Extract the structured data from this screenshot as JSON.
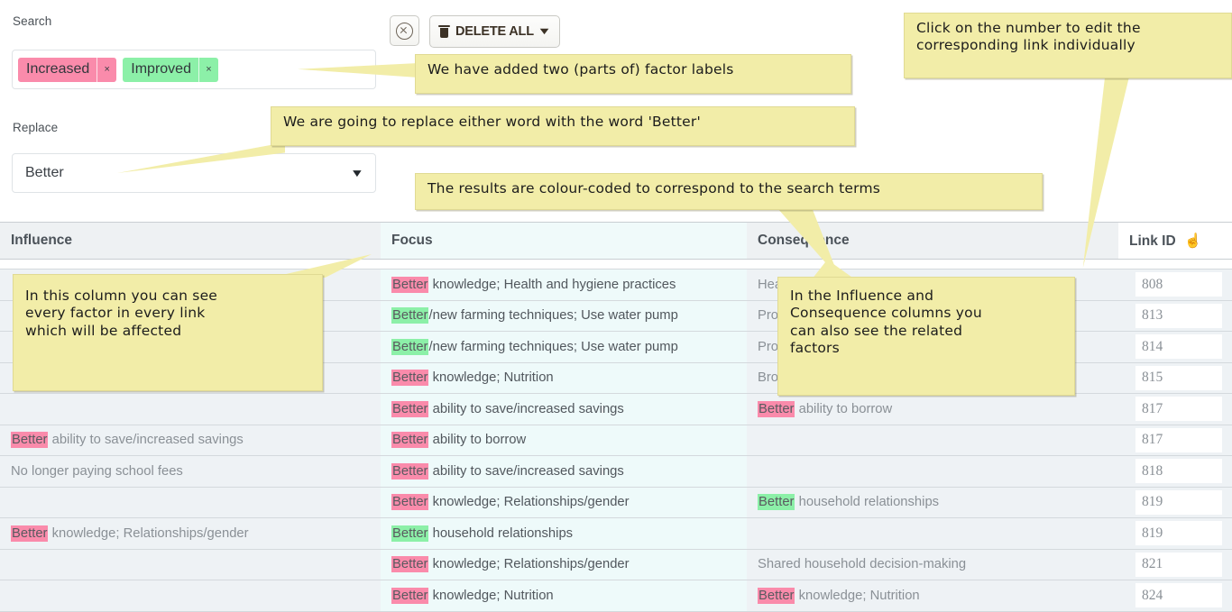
{
  "form": {
    "search_label": "Search",
    "replace_label": "Replace",
    "chips": [
      {
        "text": "Increased",
        "remove": "×",
        "color": "#fa8bab",
        "tone": "pink"
      },
      {
        "text": "Improved",
        "remove": "×",
        "color": "#8cf0a8",
        "tone": "green"
      }
    ],
    "replace_value": "Better",
    "replace_caret": "▼"
  },
  "toolbar": {
    "clear_icon": "clear-circle-icon",
    "delete_all_label": "DELETE ALL",
    "delete_all_caret": "▼",
    "trash_icon": "trash-icon"
  },
  "table": {
    "headers": {
      "influence": "Influence",
      "focus": "Focus",
      "consequence": "Consequence",
      "link_id": "Link ID",
      "link_id_icon": "pointing-hand-icon"
    },
    "rows": [
      {
        "influence": [],
        "focus": [
          {
            "t": "Better",
            "hl": "pink"
          },
          {
            "t": " knowledge; Health and hygiene practices",
            "hl": "none"
          }
        ],
        "consequence": [
          {
            "t": "Hea",
            "hl": "none"
          }
        ],
        "link_id": "808"
      },
      {
        "influence": [],
        "focus": [
          {
            "t": "Better",
            "hl": "green"
          },
          {
            "t": "/new farming techniques; Use water pump",
            "hl": "none"
          }
        ],
        "consequence": [
          {
            "t": "Pro",
            "hl": "none"
          }
        ],
        "link_id": "813"
      },
      {
        "influence": [],
        "focus": [
          {
            "t": "Better",
            "hl": "green"
          },
          {
            "t": "/new farming techniques; Use water pump",
            "hl": "none"
          }
        ],
        "consequence": [
          {
            "t": "Pro",
            "hl": "none"
          }
        ],
        "link_id": "814"
      },
      {
        "influence": [],
        "focus": [
          {
            "t": "Better",
            "hl": "pink"
          },
          {
            "t": " knowledge; Nutrition",
            "hl": "none"
          }
        ],
        "consequence": [
          {
            "t": "Bro",
            "hl": "none"
          }
        ],
        "link_id": "815"
      },
      {
        "influence": [],
        "focus": [
          {
            "t": "Better",
            "hl": "pink"
          },
          {
            "t": " ability to save/increased savings",
            "hl": "none"
          }
        ],
        "consequence": [
          {
            "t": "Better",
            "hl": "pink"
          },
          {
            "t": " ability to borrow",
            "hl": "none"
          }
        ],
        "link_id": "817"
      },
      {
        "influence": [
          {
            "t": "Better",
            "hl": "pink"
          },
          {
            "t": " ability to save/increased savings",
            "hl": "none"
          }
        ],
        "focus": [
          {
            "t": "Better",
            "hl": "pink"
          },
          {
            "t": " ability to borrow",
            "hl": "none"
          }
        ],
        "consequence": [],
        "link_id": "817"
      },
      {
        "influence": [
          {
            "t": "No longer paying school fees",
            "hl": "none"
          }
        ],
        "focus": [
          {
            "t": "Better",
            "hl": "pink"
          },
          {
            "t": " ability to save/increased savings",
            "hl": "none"
          }
        ],
        "consequence": [],
        "link_id": "818"
      },
      {
        "influence": [],
        "focus": [
          {
            "t": "Better",
            "hl": "pink"
          },
          {
            "t": " knowledge; Relationships/gender",
            "hl": "none"
          }
        ],
        "consequence": [
          {
            "t": "Better",
            "hl": "green"
          },
          {
            "t": " household relationships",
            "hl": "none"
          }
        ],
        "link_id": "819"
      },
      {
        "influence": [
          {
            "t": "Better",
            "hl": "pink"
          },
          {
            "t": " knowledge; Relationships/gender",
            "hl": "none"
          }
        ],
        "focus": [
          {
            "t": "Better",
            "hl": "green"
          },
          {
            "t": " household relationships",
            "hl": "none"
          }
        ],
        "consequence": [],
        "link_id": "819"
      },
      {
        "influence": [],
        "focus": [
          {
            "t": "Better",
            "hl": "pink"
          },
          {
            "t": " knowledge; Relationships/gender",
            "hl": "none"
          }
        ],
        "consequence": [
          {
            "t": "Shared household decision-making",
            "hl": "none"
          }
        ],
        "link_id": "821"
      },
      {
        "influence": [],
        "focus": [
          {
            "t": "Better",
            "hl": "pink"
          },
          {
            "t": " knowledge; Nutrition",
            "hl": "none"
          }
        ],
        "consequence": [
          {
            "t": "Better",
            "hl": "pink"
          },
          {
            "t": " knowledge; Nutrition",
            "hl": "none"
          }
        ],
        "link_id": "824"
      }
    ]
  },
  "callouts": {
    "labels": "We have added two (parts of) factor labels",
    "replace": "We are going to replace either word with the word 'Better'",
    "results": "The results are colour-coded to correspond to the search terms",
    "click_line1": "Click on the number to edit the",
    "click_line2": "corresponding link individually",
    "column_line1": "In this column you can see",
    "column_line2": "every factor in every link",
    "column_line3": "which will be affected",
    "related_line1": "In the Influence and",
    "related_line2": "Consequence columns you",
    "related_line3": "can also see the related",
    "related_line4": "factors"
  },
  "colors": {
    "search_term_1": "#fa8bab",
    "search_term_2": "#8cf0a8",
    "callout_bg": "#f2eda8",
    "focus_column_bg": "#eefafa",
    "side_column_bg": "#eef2f5"
  }
}
